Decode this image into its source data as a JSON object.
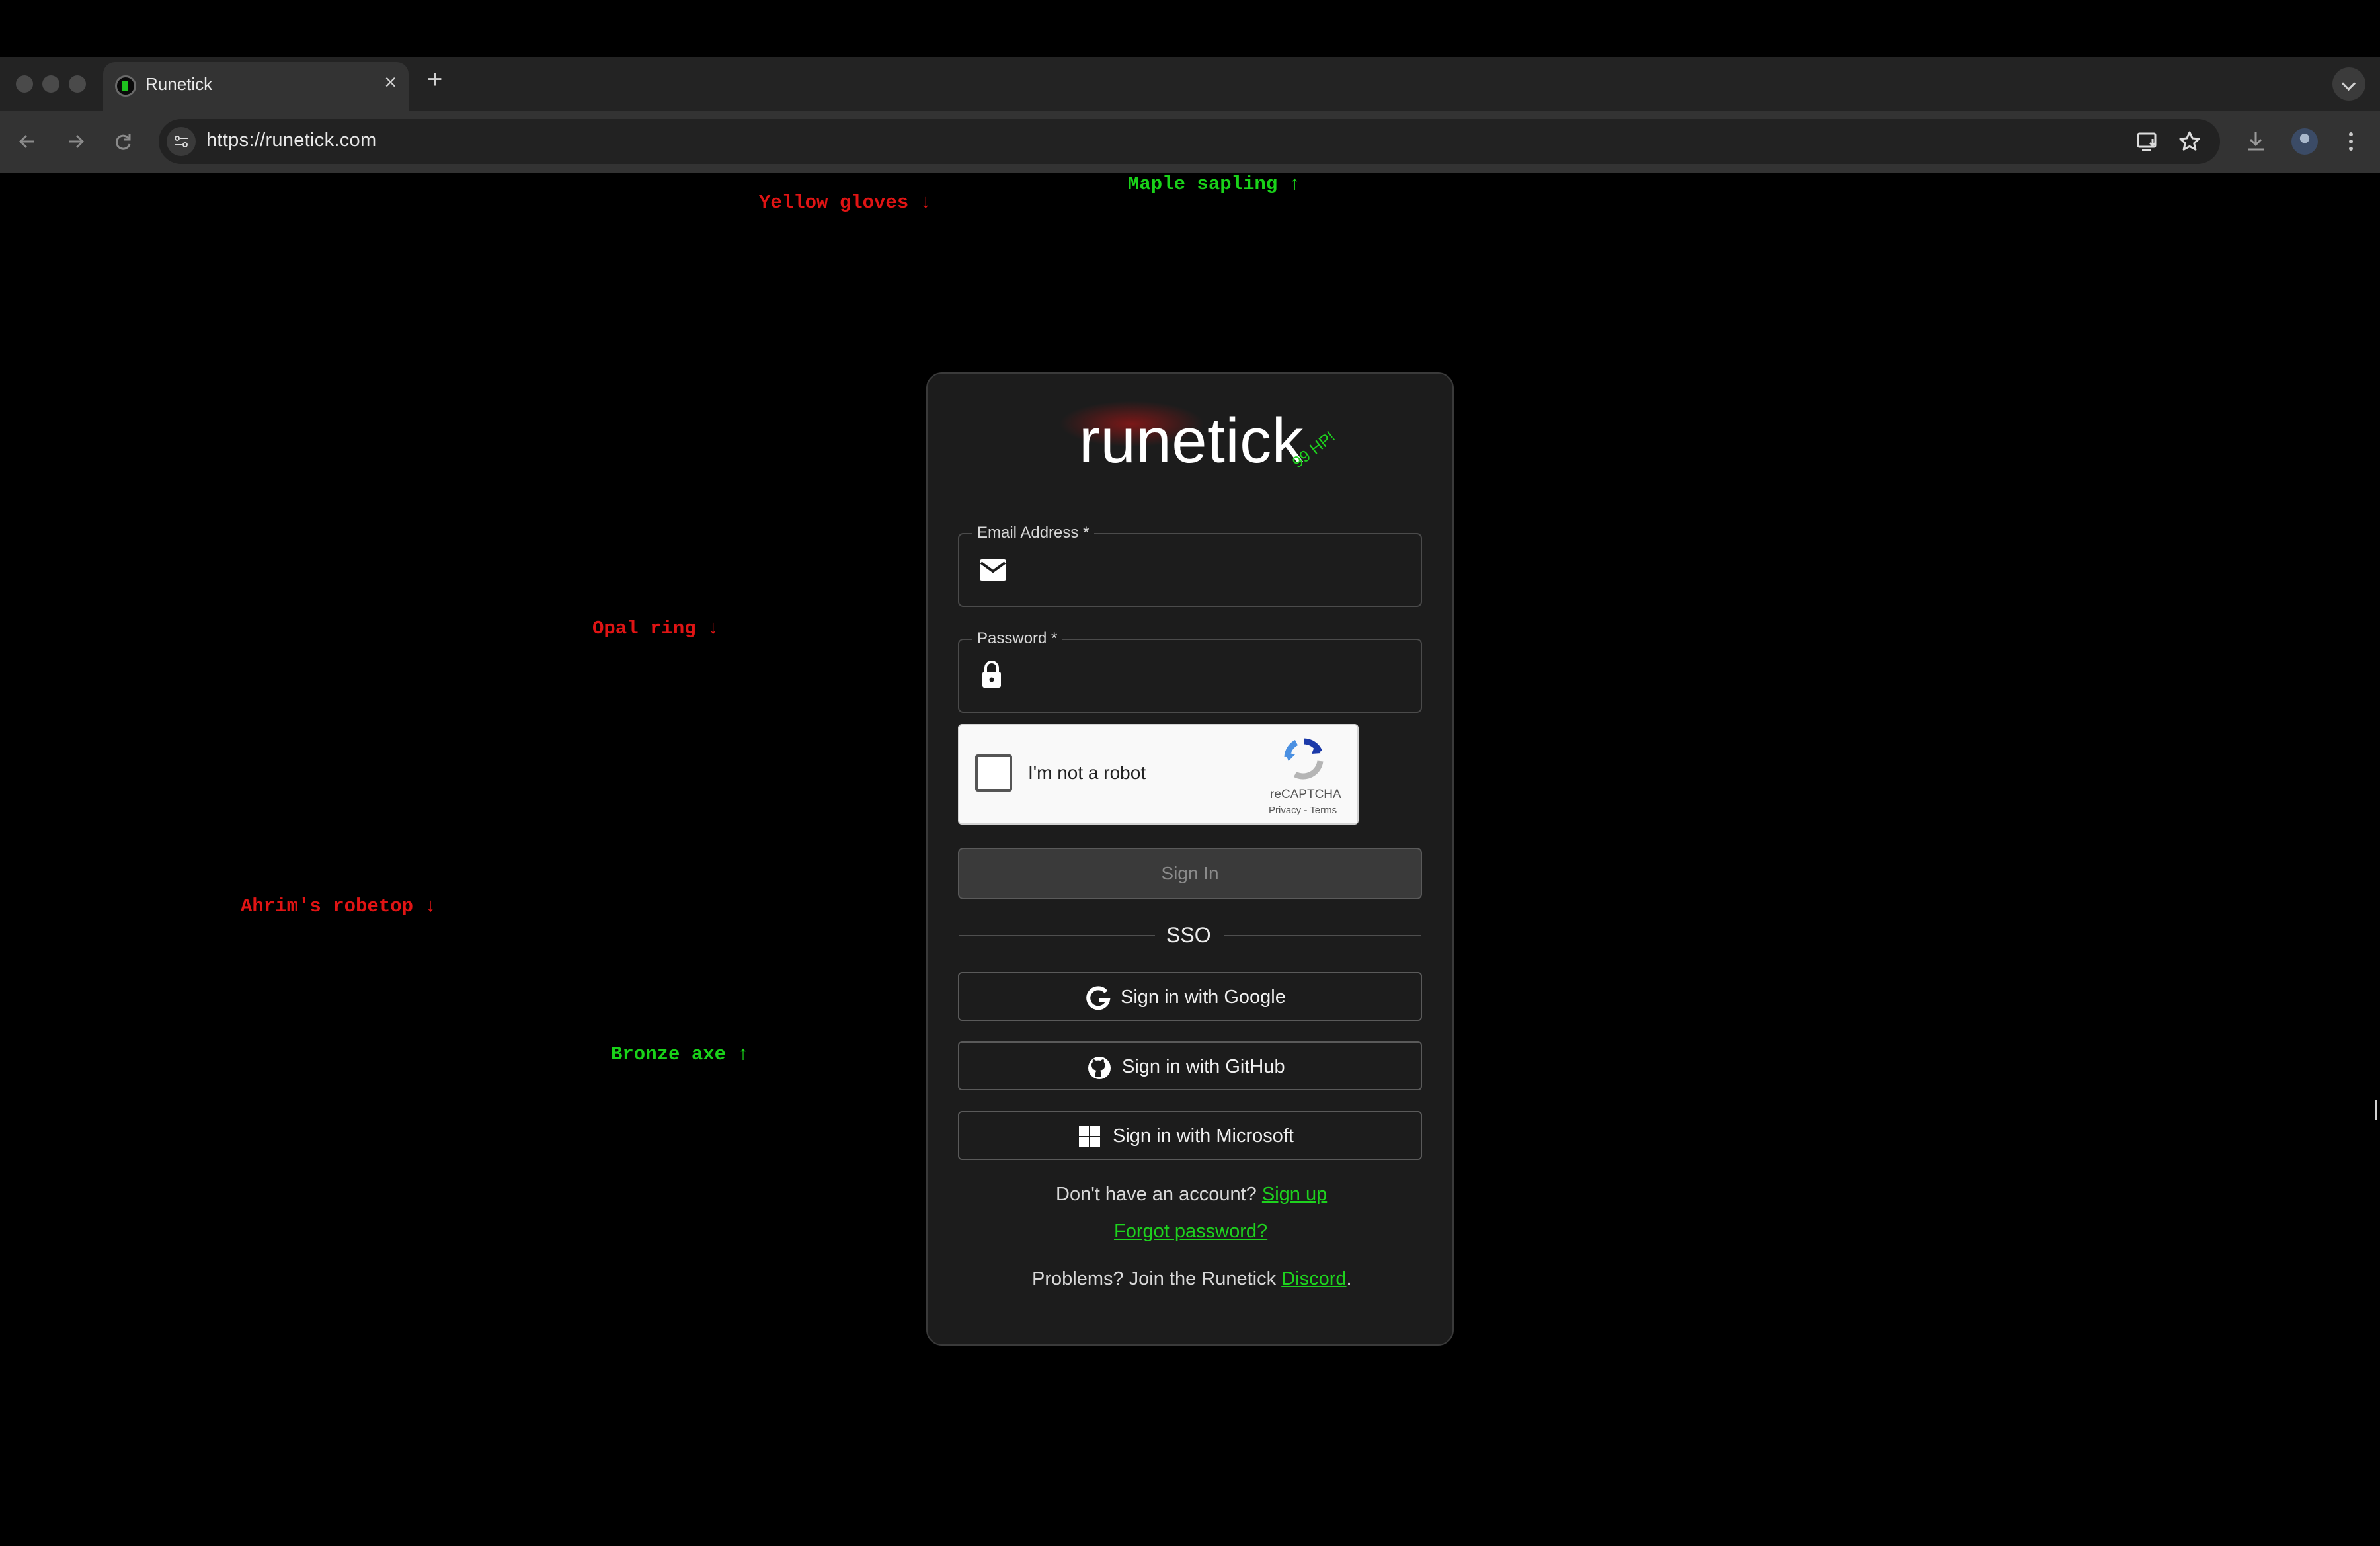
{
  "browser": {
    "tab_title": "Runetick",
    "tab_close": "×",
    "new_tab": "+",
    "url": "https://runetick.com"
  },
  "background_items": [
    {
      "label": "Yellow gloves ↓",
      "color": "red"
    },
    {
      "label": "Maple sapling ↑",
      "color": "green"
    },
    {
      "label": "Opal ring ↓",
      "color": "red"
    },
    {
      "label": "Ahrim's robetop ↓",
      "color": "red"
    },
    {
      "label": "Bronze axe ↑",
      "color": "green"
    }
  ],
  "login": {
    "logo": "runetick",
    "badge": "99 HP!",
    "email_label": "Email Address *",
    "email_value": "",
    "password_label": "Password *",
    "password_value": "",
    "captcha_text": "I'm not a robot",
    "captcha_brand": "reCAPTCHA",
    "captcha_links": "Privacy - Terms",
    "sign_in": "Sign In",
    "sso_divider": "SSO",
    "sso_google": "Sign in with Google",
    "sso_github": "Sign in with GitHub",
    "sso_microsoft": "Sign in with Microsoft",
    "no_account": "Don't have an account?",
    "sign_up": "Sign up",
    "forgot_password": "Forgot password?",
    "problems": "Problems? Join the Runetick",
    "discord": "Discord",
    "period": "."
  },
  "colors": {
    "accent_green": "#1ed21e",
    "loss_red": "#e01414",
    "card_bg": "#1c1c1c",
    "page_bg": "#000000"
  }
}
